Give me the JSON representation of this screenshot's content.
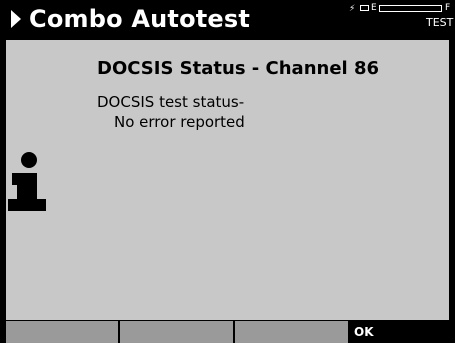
{
  "header": {
    "title": "Combo Autotest",
    "status": {
      "batt_empty_label": "E",
      "batt_full_label": "F",
      "test_badge": "TEST"
    }
  },
  "dialog": {
    "title": "DOCSIS Status - Channel 86",
    "message_line1": "DOCSIS test status-",
    "message_line2": "No error reported",
    "icon": "info-icon"
  },
  "softkeys": [
    {
      "label": ""
    },
    {
      "label": ""
    },
    {
      "label": ""
    },
    {
      "label": "OK"
    }
  ]
}
